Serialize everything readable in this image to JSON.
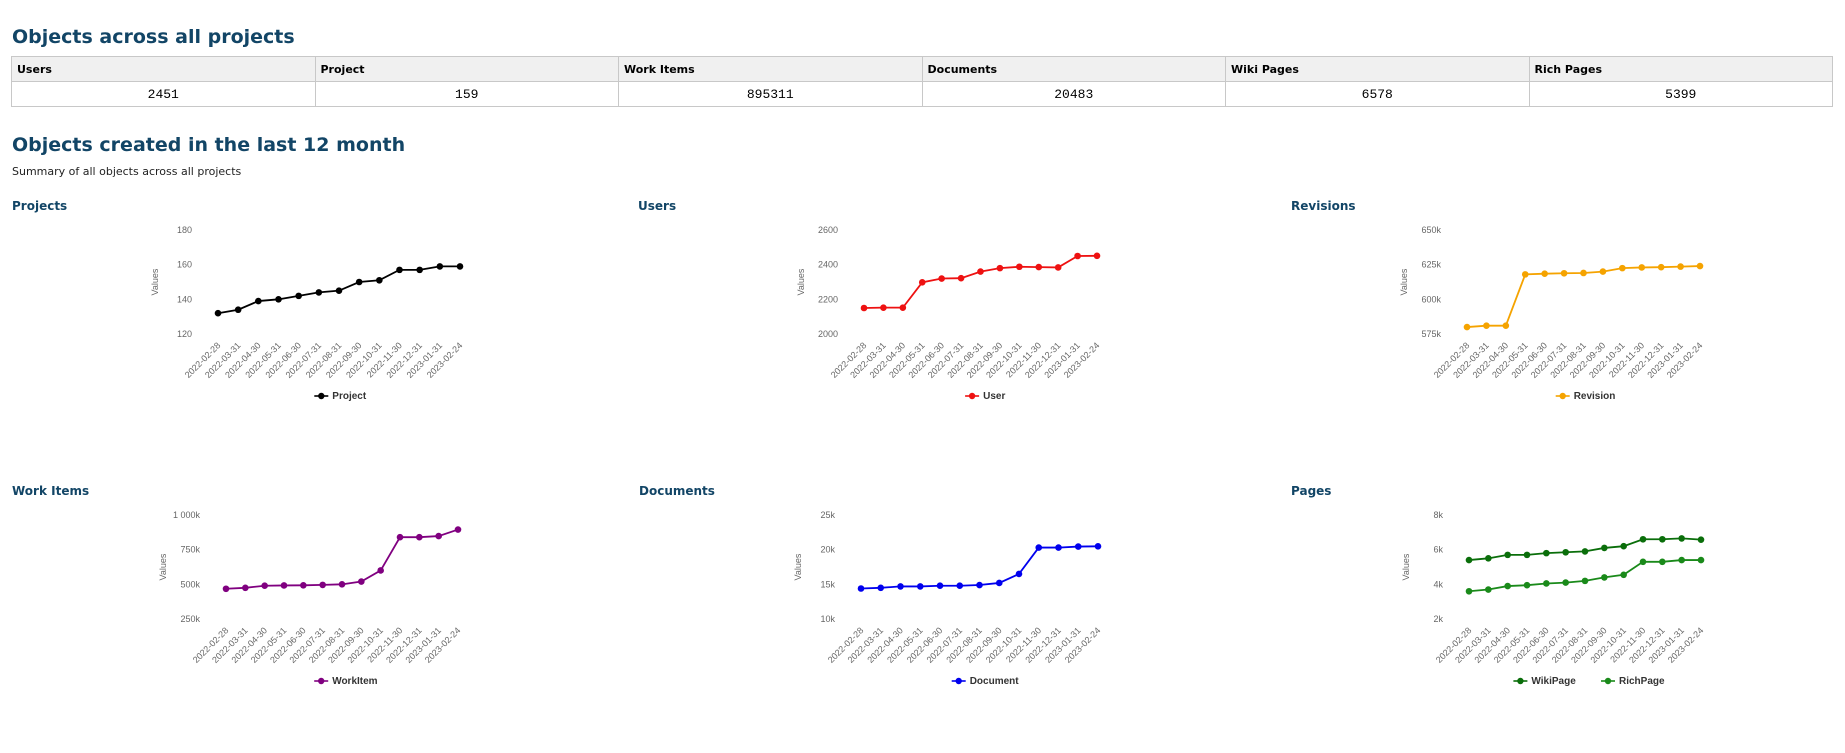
{
  "page": {
    "heading_objects": "Objects across all projects",
    "heading_created": "Objects created in the last 12 month",
    "subtitle": "Summary of all objects across all projects"
  },
  "summary_table": {
    "headers": [
      "Users",
      "Project",
      "Work Items",
      "Documents",
      "Wiki Pages",
      "Rich Pages"
    ],
    "values": [
      "2451",
      "159",
      "895311",
      "20483",
      "6578",
      "5399"
    ]
  },
  "charts": [
    {
      "title": "Projects"
    },
    {
      "title": "Users"
    },
    {
      "title": "Revisions"
    },
    {
      "title": "Work Items"
    },
    {
      "title": "Documents"
    },
    {
      "title": "Pages"
    }
  ],
  "chart_data": [
    {
      "type": "line",
      "ylabel": "Values",
      "x": [
        "2022-02-28",
        "2022-03-31",
        "2022-04-30",
        "2022-05-31",
        "2022-06-30",
        "2022-07-31",
        "2022-08-31",
        "2022-09-30",
        "2022-10-31",
        "2022-11-30",
        "2022-12-31",
        "2023-01-31",
        "2023-02-24"
      ],
      "yticks": [
        120,
        140,
        160,
        180
      ],
      "ytick_labels": [
        "120",
        "140",
        "160",
        "180"
      ],
      "ylim": [
        120,
        180
      ],
      "series": [
        {
          "name": "Project",
          "color": "#000000",
          "values": [
            132,
            134,
            139,
            140,
            142,
            144,
            145,
            150,
            151,
            157,
            157,
            159,
            159
          ]
        }
      ],
      "legend": "bottom"
    },
    {
      "type": "line",
      "ylabel": "Values",
      "x": [
        "2022-02-28",
        "2022-03-31",
        "2022-04-30",
        "2022-05-31",
        "2022-06-30",
        "2022-07-31",
        "2022-08-31",
        "2022-09-30",
        "2022-10-31",
        "2022-11-30",
        "2022-12-31",
        "2023-01-31",
        "2023-02-24"
      ],
      "yticks": [
        2000,
        2200,
        2400,
        2600
      ],
      "ytick_labels": [
        "2000",
        "2200",
        "2400",
        "2600"
      ],
      "ylim": [
        2000,
        2600
      ],
      "series": [
        {
          "name": "User",
          "color": "#ee1111",
          "values": [
            2150,
            2152,
            2152,
            2298,
            2320,
            2322,
            2360,
            2380,
            2388,
            2386,
            2384,
            2450,
            2451
          ]
        }
      ],
      "legend": "bottom"
    },
    {
      "type": "line",
      "ylabel": "Values",
      "x": [
        "2022-02-28",
        "2022-03-31",
        "2022-04-30",
        "2022-05-31",
        "2022-06-30",
        "2022-07-31",
        "2022-08-31",
        "2022-09-30",
        "2022-10-31",
        "2022-11-30",
        "2022-12-31",
        "2023-01-31",
        "2023-02-24"
      ],
      "yticks": [
        575000,
        600000,
        625000,
        650000
      ],
      "ytick_labels": [
        "575k",
        "600k",
        "625k",
        "650k"
      ],
      "ylim": [
        575000,
        650000
      ],
      "series": [
        {
          "name": "Revision",
          "color": "#f5a300",
          "values": [
            580000,
            581000,
            581000,
            618000,
            618500,
            618800,
            619000,
            620000,
            622500,
            623000,
            623200,
            623600,
            624000
          ]
        }
      ],
      "legend": "bottom"
    },
    {
      "type": "line",
      "ylabel": "Values",
      "x": [
        "2022-02-28",
        "2022-03-31",
        "2022-04-30",
        "2022-05-31",
        "2022-06-30",
        "2022-07-31",
        "2022-08-31",
        "2022-09-30",
        "2022-10-31",
        "2022-11-30",
        "2022-12-31",
        "2023-01-31",
        "2023-02-24"
      ],
      "yticks": [
        250000,
        500000,
        750000,
        1000000
      ],
      "ytick_labels": [
        "250k",
        "500k",
        "750k",
        "1 000k"
      ],
      "ylim": [
        250000,
        1000000
      ],
      "series": [
        {
          "name": "WorkItem",
          "color": "#800080",
          "values": [
            468000,
            475000,
            490000,
            492000,
            493000,
            496000,
            500000,
            520000,
            600000,
            840000,
            840000,
            848000,
            895000
          ]
        }
      ],
      "legend": "bottom"
    },
    {
      "type": "line",
      "ylabel": "Values",
      "x": [
        "2022-02-28",
        "2022-03-31",
        "2022-04-30",
        "2022-05-31",
        "2022-06-30",
        "2022-07-31",
        "2022-08-31",
        "2022-09-30",
        "2022-10-31",
        "2022-11-30",
        "2022-12-31",
        "2023-01-31",
        "2023-02-24"
      ],
      "yticks": [
        10000,
        15000,
        20000,
        25000
      ],
      "ytick_labels": [
        "10k",
        "15k",
        "20k",
        "25k"
      ],
      "ylim": [
        10000,
        25000
      ],
      "series": [
        {
          "name": "Document",
          "color": "#0000ee",
          "values": [
            14400,
            14500,
            14700,
            14700,
            14800,
            14800,
            14900,
            15200,
            16500,
            20300,
            20300,
            20450,
            20483
          ]
        }
      ],
      "legend": "bottom"
    },
    {
      "type": "line",
      "ylabel": "Values",
      "x": [
        "2022-02-28",
        "2022-03-31",
        "2022-04-30",
        "2022-05-31",
        "2022-06-30",
        "2022-07-31",
        "2022-08-31",
        "2022-09-30",
        "2022-10-31",
        "2022-11-30",
        "2022-12-31",
        "2023-01-31",
        "2023-02-24"
      ],
      "yticks": [
        2000,
        4000,
        6000,
        8000
      ],
      "ytick_labels": [
        "2k",
        "4k",
        "6k",
        "8k"
      ],
      "ylim": [
        2000,
        8000
      ],
      "series": [
        {
          "name": "WikiPage",
          "color": "#0a6e0a",
          "values": [
            5400,
            5500,
            5700,
            5700,
            5800,
            5850,
            5900,
            6100,
            6200,
            6600,
            6600,
            6650,
            6578
          ]
        },
        {
          "name": "RichPage",
          "color": "#1a8a1a",
          "values": [
            3600,
            3700,
            3900,
            3950,
            4050,
            4100,
            4200,
            4400,
            4550,
            5300,
            5300,
            5400,
            5399
          ]
        }
      ],
      "legend": "bottom"
    }
  ]
}
